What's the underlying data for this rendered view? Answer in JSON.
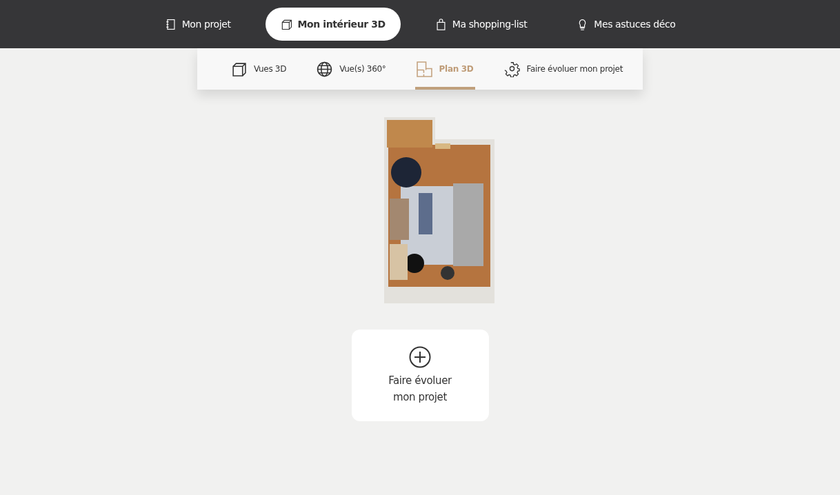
{
  "main_nav": [
    {
      "label": "Mon projet",
      "kind": "notebook",
      "selected": false
    },
    {
      "label": "Mon intérieur 3D",
      "kind": "cube",
      "selected": true
    },
    {
      "label": "Ma shopping-list",
      "kind": "bag",
      "selected": false
    },
    {
      "label": "Mes astuces déco",
      "kind": "bulb",
      "selected": false
    }
  ],
  "sub_nav": [
    {
      "label": "Vues 3D",
      "kind": "cube",
      "selected": false
    },
    {
      "label": "Vue(s) 360°",
      "kind": "globe",
      "selected": false
    },
    {
      "label": "Plan 3D",
      "kind": "plan",
      "selected": true
    },
    {
      "label": "Faire évoluer mon projet",
      "kind": "gear",
      "selected": false
    }
  ],
  "add_card": {
    "label": "Faire évoluer mon projet"
  }
}
